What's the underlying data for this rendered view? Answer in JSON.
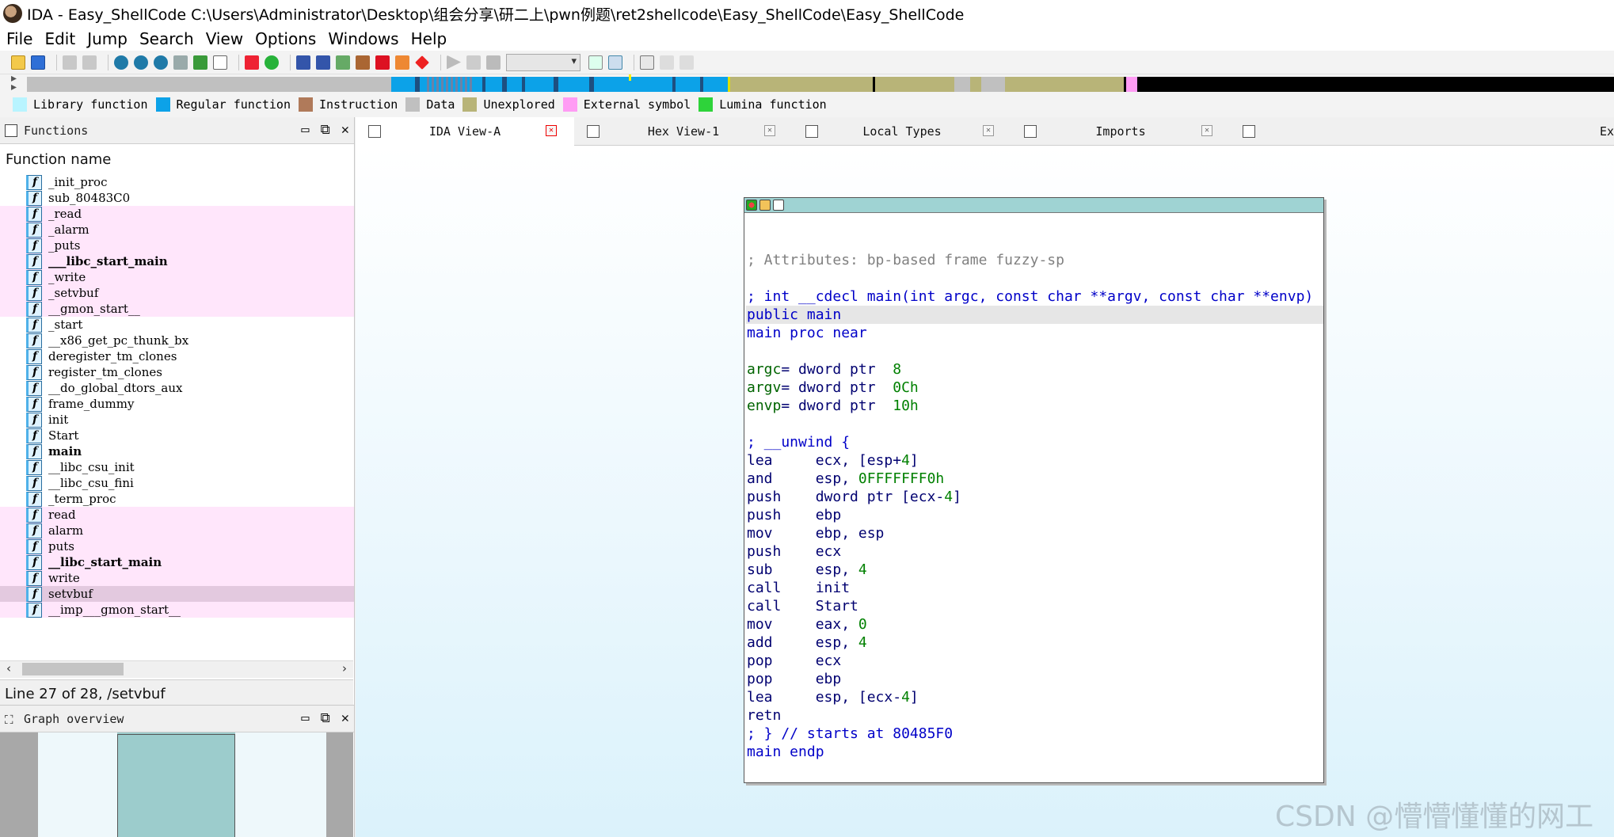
{
  "window": {
    "title": "IDA - Easy_ShellCode C:\\Users\\Administrator\\Desktop\\组会分享\\研二上\\pwn例题\\ret2shellcode\\Easy_ShellCode\\Easy_ShellCode"
  },
  "menu": [
    "File",
    "Edit",
    "Jump",
    "Search",
    "View",
    "Options",
    "Windows",
    "Help"
  ],
  "legend": [
    {
      "label": "Library function",
      "color": "#b8f4ff"
    },
    {
      "label": "Regular function",
      "color": "#0ca2e8"
    },
    {
      "label": "Instruction",
      "color": "#b07a5a"
    },
    {
      "label": "Data",
      "color": "#c0c0c0"
    },
    {
      "label": "Unexplored",
      "color": "#b8b478"
    },
    {
      "label": "External symbol",
      "color": "#ff9cf4"
    },
    {
      "label": "Lumina function",
      "color": "#2ed33a"
    }
  ],
  "functions_panel": {
    "title": "Functions",
    "column_header": "Function name",
    "items": [
      {
        "name": "_init_proc",
        "style": "normal"
      },
      {
        "name": "sub_80483C0",
        "style": "normal"
      },
      {
        "name": "_read",
        "style": "pink"
      },
      {
        "name": "_alarm",
        "style": "pink"
      },
      {
        "name": "_puts",
        "style": "pink"
      },
      {
        "name": "___libc_start_main",
        "style": "pink-bold"
      },
      {
        "name": "_write",
        "style": "pink"
      },
      {
        "name": "_setvbuf",
        "style": "pink"
      },
      {
        "name": "__gmon_start__",
        "style": "pink"
      },
      {
        "name": "_start",
        "style": "normal"
      },
      {
        "name": "__x86_get_pc_thunk_bx",
        "style": "normal"
      },
      {
        "name": "deregister_tm_clones",
        "style": "normal"
      },
      {
        "name": "register_tm_clones",
        "style": "normal"
      },
      {
        "name": "__do_global_dtors_aux",
        "style": "normal"
      },
      {
        "name": "frame_dummy",
        "style": "normal"
      },
      {
        "name": "init",
        "style": "normal"
      },
      {
        "name": "Start",
        "style": "normal"
      },
      {
        "name": "main",
        "style": "bold"
      },
      {
        "name": "__libc_csu_init",
        "style": "normal"
      },
      {
        "name": "__libc_csu_fini",
        "style": "normal"
      },
      {
        "name": "_term_proc",
        "style": "normal"
      },
      {
        "name": "read",
        "style": "pink"
      },
      {
        "name": "alarm",
        "style": "pink"
      },
      {
        "name": "puts",
        "style": "pink"
      },
      {
        "name": "__libc_start_main",
        "style": "pink-bold"
      },
      {
        "name": "write",
        "style": "pink"
      },
      {
        "name": "setvbuf",
        "style": "selected"
      },
      {
        "name": "__imp___gmon_start__",
        "style": "pink"
      }
    ],
    "status": "Line 27 of 28, /setvbuf"
  },
  "graph_overview": {
    "title": "Graph overview"
  },
  "tabs": [
    {
      "label": "IDA View-A",
      "active": true
    },
    {
      "label": "Hex View-1",
      "active": false
    },
    {
      "label": "Local Types",
      "active": false
    },
    {
      "label": "Imports",
      "active": false
    },
    {
      "label": "Ex",
      "active": false
    }
  ],
  "disassembly": [
    {
      "parts": []
    },
    {
      "parts": [
        {
          "t": "; Attributes: bp-based frame fuzzy-sp",
          "c": "cmt"
        }
      ]
    },
    {
      "parts": []
    },
    {
      "parts": [
        {
          "t": "; int __cdecl main(int argc, const char **argv, const char **envp)",
          "c": "blue"
        }
      ]
    },
    {
      "parts": [
        {
          "t": "public main",
          "c": "blue"
        }
      ],
      "hl": true
    },
    {
      "parts": [
        {
          "t": "main proc near",
          "c": "blue"
        }
      ]
    },
    {
      "parts": []
    },
    {
      "parts": [
        {
          "t": "argc",
          "c": "green"
        },
        {
          "t": "= dword ptr  ",
          "c": "blk"
        },
        {
          "t": "8",
          "c": "num"
        }
      ]
    },
    {
      "parts": [
        {
          "t": "argv",
          "c": "green"
        },
        {
          "t": "= dword ptr  ",
          "c": "blk"
        },
        {
          "t": "0Ch",
          "c": "num"
        }
      ]
    },
    {
      "parts": [
        {
          "t": "envp",
          "c": "green"
        },
        {
          "t": "= dword ptr  ",
          "c": "blk"
        },
        {
          "t": "10h",
          "c": "num"
        }
      ]
    },
    {
      "parts": []
    },
    {
      "parts": [
        {
          "t": "; __unwind {",
          "c": "blue"
        }
      ]
    },
    {
      "parts": [
        {
          "t": "lea     ecx, [esp+",
          "c": "blk"
        },
        {
          "t": "4",
          "c": "num"
        },
        {
          "t": "]",
          "c": "blk"
        }
      ]
    },
    {
      "parts": [
        {
          "t": "and     esp, ",
          "c": "blk"
        },
        {
          "t": "0FFFFFFF0h",
          "c": "num"
        }
      ]
    },
    {
      "parts": [
        {
          "t": "push    dword ptr [ecx-",
          "c": "blk"
        },
        {
          "t": "4",
          "c": "num"
        },
        {
          "t": "]",
          "c": "blk"
        }
      ]
    },
    {
      "parts": [
        {
          "t": "push    ebp",
          "c": "blk"
        }
      ]
    },
    {
      "parts": [
        {
          "t": "mov     ebp, esp",
          "c": "blk"
        }
      ]
    },
    {
      "parts": [
        {
          "t": "push    ecx",
          "c": "blk"
        }
      ]
    },
    {
      "parts": [
        {
          "t": "sub     esp, ",
          "c": "blk"
        },
        {
          "t": "4",
          "c": "num"
        }
      ]
    },
    {
      "parts": [
        {
          "t": "call    init",
          "c": "blk"
        }
      ]
    },
    {
      "parts": [
        {
          "t": "call    Start",
          "c": "blk"
        }
      ]
    },
    {
      "parts": [
        {
          "t": "mov     eax, ",
          "c": "blk"
        },
        {
          "t": "0",
          "c": "num"
        }
      ]
    },
    {
      "parts": [
        {
          "t": "add     esp, ",
          "c": "blk"
        },
        {
          "t": "4",
          "c": "num"
        }
      ]
    },
    {
      "parts": [
        {
          "t": "pop     ecx",
          "c": "blk"
        }
      ]
    },
    {
      "parts": [
        {
          "t": "pop     ebp",
          "c": "blk"
        }
      ]
    },
    {
      "parts": [
        {
          "t": "lea     esp, [ecx-",
          "c": "blk"
        },
        {
          "t": "4",
          "c": "num"
        },
        {
          "t": "]",
          "c": "blk"
        }
      ]
    },
    {
      "parts": [
        {
          "t": "retn",
          "c": "blk"
        }
      ]
    },
    {
      "parts": [
        {
          "t": "; } // starts at 80485F0",
          "c": "blue"
        }
      ]
    },
    {
      "parts": [
        {
          "t": "main endp",
          "c": "blue"
        }
      ]
    }
  ],
  "watermark": "CSDN @懵懵懂懂的网工"
}
